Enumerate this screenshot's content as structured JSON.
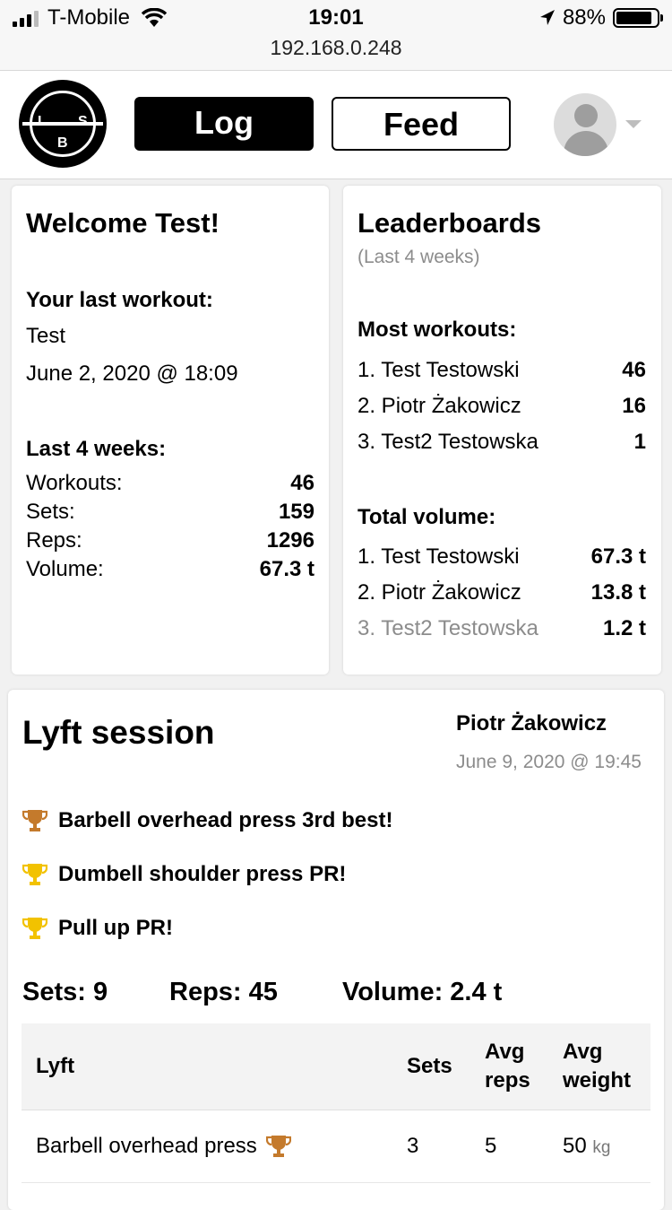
{
  "status_bar": {
    "carrier": "T-Mobile",
    "time": "19:01",
    "url": "192.168.0.248",
    "battery": "88%"
  },
  "header": {
    "logo_letters": [
      "L",
      "S",
      "B"
    ],
    "log_label": "Log",
    "feed_label": "Feed"
  },
  "welcome": {
    "title": "Welcome Test!",
    "last_workout_label": "Your last workout:",
    "last_workout_name": "Test",
    "last_workout_date": "June 2, 2020 @ 18:09",
    "last4_label": "Last 4 weeks:",
    "stats": [
      {
        "label": "Workouts:",
        "value": "46"
      },
      {
        "label": "Sets:",
        "value": "159"
      },
      {
        "label": "Reps:",
        "value": "1296"
      },
      {
        "label": "Volume:",
        "value": "67.3 t"
      }
    ]
  },
  "leaderboards": {
    "title": "Leaderboards",
    "subtitle": "(Last 4 weeks)",
    "most_workouts_label": "Most workouts:",
    "most_workouts": [
      {
        "name": "1. Test Testowski",
        "value": "46"
      },
      {
        "name": "2. Piotr Żakowicz",
        "value": "16"
      },
      {
        "name": "3. Test2 Testowska",
        "value": "1"
      }
    ],
    "total_volume_label": "Total volume:",
    "total_volume": [
      {
        "name": "1. Test Testowski",
        "value": "67.3 t"
      },
      {
        "name": "2. Piotr Żakowicz",
        "value": "13.8 t"
      },
      {
        "name": "3. Test2 Testowska",
        "value": "1.2 t"
      }
    ]
  },
  "session": {
    "title": "Lyft session",
    "author": "Piotr Żakowicz",
    "date": "June 9, 2020 @ 19:45",
    "achievements": [
      {
        "text": "Barbell overhead press 3rd best!",
        "icon": "trophy-bronze-icon",
        "color": "#c47a2c"
      },
      {
        "text": "Dumbell shoulder press PR!",
        "icon": "trophy-gold-icon",
        "color": "#f2c200"
      },
      {
        "text": "Pull up PR!",
        "icon": "trophy-gold-icon",
        "color": "#f2c200"
      }
    ],
    "sets_summary": "Sets: 9",
    "reps_summary": "Reps: 45",
    "volume_summary": "Volume: 2.4 t",
    "table": {
      "headers": {
        "lyft": "Lyft",
        "sets": "Sets",
        "avg_reps_1": "Avg",
        "avg_reps_2": "reps",
        "avg_weight_1": "Avg",
        "avg_weight_2": "weight"
      },
      "rows": [
        {
          "lyft": "Barbell overhead press",
          "sets": "3",
          "avg_reps": "5",
          "avg_weight": "50",
          "unit": "kg"
        }
      ]
    }
  }
}
